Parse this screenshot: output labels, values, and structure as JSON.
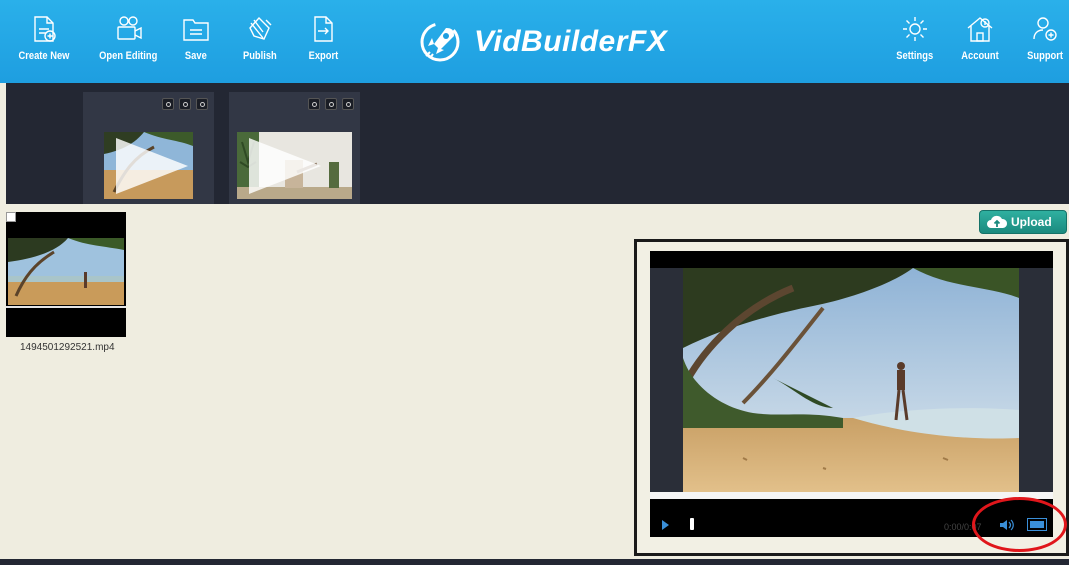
{
  "toolbar": {
    "create_new": "Create New",
    "open_editing": "Open Editing",
    "save": "Save",
    "publish": "Publish",
    "export": "Export",
    "settings": "Settings",
    "account": "Account",
    "support": "Support"
  },
  "brand": {
    "name": "VidBuilderFX"
  },
  "library": {
    "upload_label": "Upload",
    "items": [
      {
        "filename": "1494501292521.mp4"
      }
    ]
  },
  "player": {
    "time": "0:00/0:07"
  },
  "colors": {
    "toolbar_blue": "#1e9ee0",
    "strip_dark": "#232733",
    "canvas_beige": "#efede0",
    "upload_teal": "#1b8a7f",
    "annotation_red": "#e0161b"
  }
}
